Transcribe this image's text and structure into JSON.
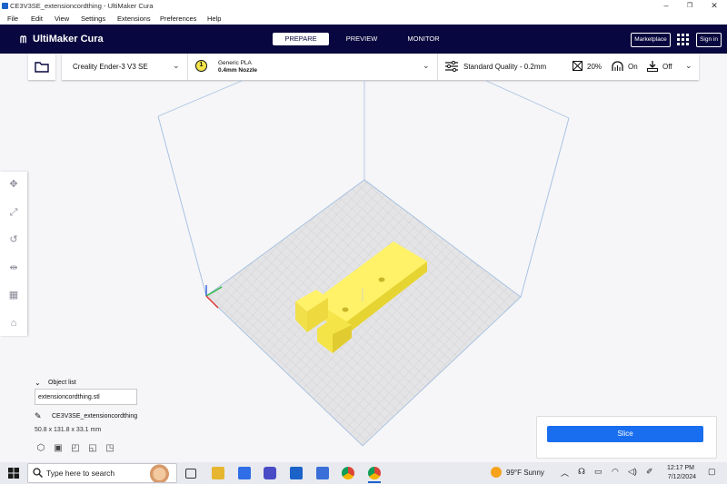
{
  "window": {
    "title": "CE3V3SE_extensioncordthing - UltiMaker Cura",
    "minimize": "–",
    "maximize": "❐",
    "close": "✕"
  },
  "menu": [
    "File",
    "Edit",
    "View",
    "Settings",
    "Extensions",
    "Preferences",
    "Help"
  ],
  "header": {
    "brand": "UltiMaker Cura",
    "stages": [
      "PREPARE",
      "PREVIEW",
      "MONITOR"
    ],
    "active_stage": "PREPARE",
    "marketplace_label": "Marketplace",
    "signin_label": "Sign in"
  },
  "config": {
    "printer": "Creality Ender-3 V3 SE",
    "extruder_number": "1",
    "material": "Generic PLA",
    "nozzle": "0.4mm Nozzle",
    "quality": "Standard Quality - 0.2mm",
    "infill": "20%",
    "support": "On",
    "adhesion": "Off"
  },
  "object_list": {
    "header": "Object list",
    "file": "extensioncordthing.stl",
    "object_name": "CE3V3SE_extensioncordthing",
    "dimensions": "50.8 x 131.8 x 33.1 mm"
  },
  "slice": {
    "label": "Slice"
  },
  "taskbar": {
    "search_placeholder": "Type here to search",
    "weather": "99°F  Sunny",
    "time": "12:17 PM",
    "date": "7/12/2024"
  },
  "colors": {
    "header_bg": "#08073f",
    "slice_button": "#196ef0",
    "model_yellow": "#ffef5a",
    "build_volume_lines": "#9bbbe0"
  }
}
